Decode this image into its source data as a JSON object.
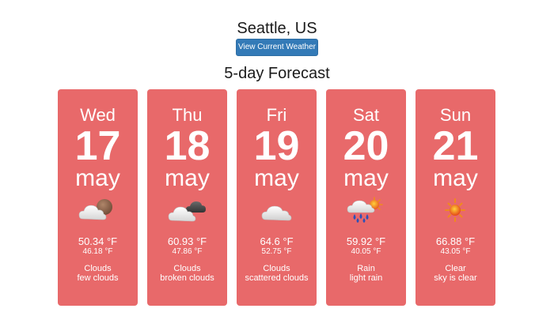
{
  "header": {
    "city": "Seattle, US",
    "view_button_label": "View Current Weather",
    "forecast_title": "5-day Forecast"
  },
  "colors": {
    "card_background": "#e8696a",
    "button_background": "#337ab7",
    "text_on_card": "#ffffff"
  },
  "days": [
    {
      "dow": "Wed",
      "date": "17",
      "month": "may",
      "icon": "few-clouds-icon",
      "high": "50.34 °F",
      "low": "46.18 °F",
      "main": "Clouds",
      "description": "few clouds"
    },
    {
      "dow": "Thu",
      "date": "18",
      "month": "may",
      "icon": "broken-clouds-icon",
      "high": "60.93 °F",
      "low": "47.86 °F",
      "main": "Clouds",
      "description": "broken clouds"
    },
    {
      "dow": "Fri",
      "date": "19",
      "month": "may",
      "icon": "scattered-clouds-icon",
      "high": "64.6 °F",
      "low": "52.75 °F",
      "main": "Clouds",
      "description": "scattered clouds"
    },
    {
      "dow": "Sat",
      "date": "20",
      "month": "may",
      "icon": "light-rain-icon",
      "high": "59.92 °F",
      "low": "40.05 °F",
      "main": "Rain",
      "description": "light rain"
    },
    {
      "dow": "Sun",
      "date": "21",
      "month": "may",
      "icon": "clear-sky-icon",
      "high": "66.88 °F",
      "low": "43.05 °F",
      "main": "Clear",
      "description": "sky is clear"
    }
  ]
}
